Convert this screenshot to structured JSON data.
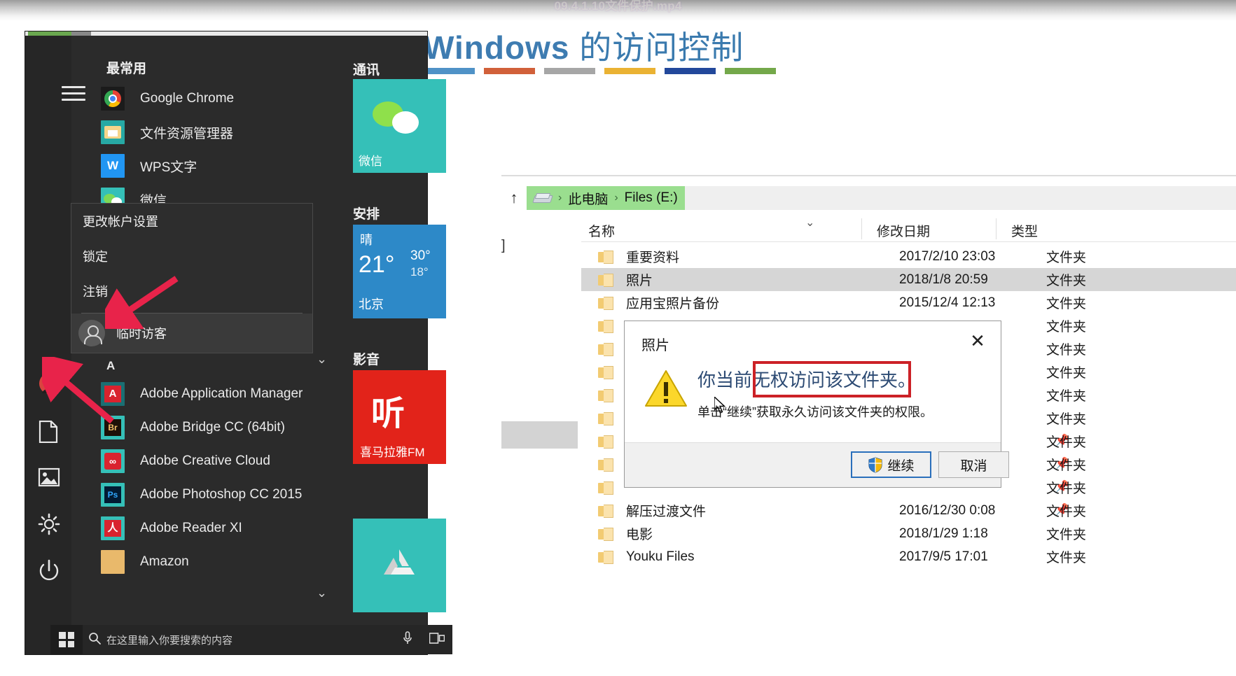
{
  "video": {
    "title": "09.4.1.10文件保护.mp4"
  },
  "slide": {
    "title_en": "Windows",
    "title_cn": " 的访问控制",
    "bar_colors": [
      "#4f92c7",
      "#d1603a",
      "#a6a6a6",
      "#eab233",
      "#22489b",
      "#74a84a"
    ]
  },
  "start_menu": {
    "hamburger_label": "menu",
    "most_used_header": "最常用",
    "most_used": [
      {
        "label": "Google Chrome",
        "icon": "chrome-icon"
      },
      {
        "label": "文件资源管理器",
        "icon": "file-explorer-icon"
      },
      {
        "label": "WPS文字",
        "icon": "wps-icon"
      },
      {
        "label": "微信",
        "icon": "wechat-icon"
      }
    ],
    "account_menu": {
      "items": [
        "更改帐户设置",
        "锁定",
        "注销"
      ],
      "user": "临时访客"
    },
    "alpha_header": "A",
    "apps": [
      {
        "label": "Adobe Application Manager",
        "icon": "adobe-application-manager-icon",
        "glyph": "A"
      },
      {
        "label": "Adobe Bridge CC (64bit)",
        "icon": "adobe-bridge-icon",
        "glyph": "Br"
      },
      {
        "label": "Adobe Creative Cloud",
        "icon": "adobe-creative-cloud-icon",
        "glyph": "∞"
      },
      {
        "label": "Adobe Photoshop CC 2015",
        "icon": "adobe-photoshop-icon",
        "glyph": "Ps"
      },
      {
        "label": "Adobe Reader XI",
        "icon": "adobe-reader-icon",
        "glyph": "人"
      },
      {
        "label": "Amazon",
        "icon": "amazon-icon",
        "glyph": ""
      }
    ],
    "rail_icons": [
      "user-avatar-icon",
      "document-icon",
      "picture-icon",
      "settings-gear-icon",
      "power-icon"
    ],
    "tiles": {
      "group1_header": "通讯",
      "group1_tile": "微信",
      "group2_header": "安排",
      "weather": {
        "condition": "晴",
        "temp": "21°",
        "high": "30°",
        "low": "18°",
        "city": "北京"
      },
      "group3_header": "影音",
      "group3_tile": "喜马拉雅FM",
      "group3_logo": "听"
    },
    "taskbar": {
      "start_icon": "windows-start-icon",
      "search_icon": "search-icon",
      "search_placeholder": "在这里输入你要搜索的内容",
      "mic_icon": "microphone-icon",
      "taskview_icon": "task-view-icon"
    }
  },
  "explorer": {
    "up_icon": "up-arrow-icon",
    "breadcrumb": [
      "此电脑",
      "Files (E:)"
    ],
    "drive_icon": "drive-icon",
    "columns": [
      "名称",
      "修改日期",
      "类型"
    ],
    "sort_chevron": "chevron-down-icon",
    "pin_icon": "pin-icon",
    "pin_count": 4,
    "rows": [
      {
        "name": "重要资料",
        "date": "2017/2/10 23:03",
        "type": "文件夹",
        "selected": false
      },
      {
        "name": "照片",
        "date": "2018/1/8 20:59",
        "type": "文件夹",
        "selected": true
      },
      {
        "name": "应用宝照片备份",
        "date": "2015/12/4 12:13",
        "type": "文件夹",
        "selected": false
      },
      {
        "name": "",
        "date": "",
        "type": "文件夹",
        "selected": false
      },
      {
        "name": "",
        "date": "",
        "type": "文件夹",
        "selected": false
      },
      {
        "name": "",
        "date": "",
        "type": "文件夹",
        "selected": false
      },
      {
        "name": "",
        "date": "",
        "type": "文件夹",
        "selected": false
      },
      {
        "name": "",
        "date": "",
        "type": "文件夹",
        "selected": false
      },
      {
        "name": "",
        "date": "",
        "type": "文件夹",
        "selected": false
      },
      {
        "name": "",
        "date": "",
        "type": "文件夹",
        "selected": false
      },
      {
        "name": "",
        "date": "",
        "type": "文件夹",
        "selected": false
      },
      {
        "name": "解压过渡文件",
        "date": "2016/12/30 0:08",
        "type": "文件夹",
        "selected": false
      },
      {
        "name": "电影",
        "date": "2018/1/29 1:18",
        "type": "文件夹",
        "selected": false
      },
      {
        "name": "Youku Files",
        "date": "2017/9/5 17:01",
        "type": "文件夹",
        "selected": false
      }
    ]
  },
  "dialog": {
    "title": "照片",
    "close_icon": "close-icon",
    "warning_icon": "warning-triangle-icon",
    "message_prefix": "你当前",
    "message_highlight": "无权访问该文件夹。",
    "sub_message": "单击“继续”获取永久访问该文件夹的权限。",
    "continue_label": "继续",
    "continue_icon": "uac-shield-icon",
    "cancel_label": "取消",
    "highlight_color": "#cc2127"
  }
}
